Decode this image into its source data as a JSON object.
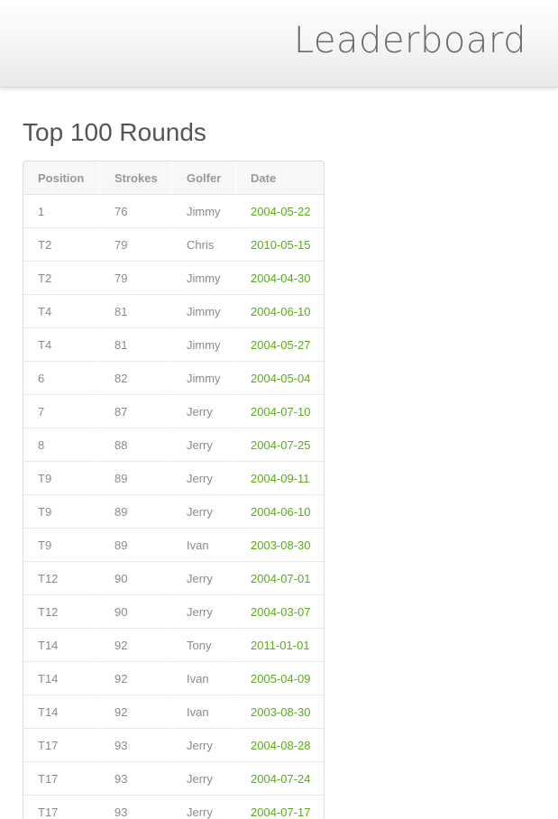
{
  "header": {
    "title": "Leaderboard"
  },
  "page": {
    "heading": "Top 100 Rounds"
  },
  "table": {
    "columns": [
      "Position",
      "Strokes",
      "Golfer",
      "Date"
    ],
    "rows": [
      {
        "position": "1",
        "strokes": "76",
        "golfer": "Jimmy",
        "date": "2004-05-22"
      },
      {
        "position": "T2",
        "strokes": "79",
        "golfer": "Chris",
        "date": "2010-05-15"
      },
      {
        "position": "T2",
        "strokes": "79",
        "golfer": "Jimmy",
        "date": "2004-04-30"
      },
      {
        "position": "T4",
        "strokes": "81",
        "golfer": "Jimmy",
        "date": "2004-06-10"
      },
      {
        "position": "T4",
        "strokes": "81",
        "golfer": "Jimmy",
        "date": "2004-05-27"
      },
      {
        "position": "6",
        "strokes": "82",
        "golfer": "Jimmy",
        "date": "2004-05-04"
      },
      {
        "position": "7",
        "strokes": "87",
        "golfer": "Jerry",
        "date": "2004-07-10"
      },
      {
        "position": "8",
        "strokes": "88",
        "golfer": "Jerry",
        "date": "2004-07-25"
      },
      {
        "position": "T9",
        "strokes": "89",
        "golfer": "Jerry",
        "date": "2004-09-11"
      },
      {
        "position": "T9",
        "strokes": "89",
        "golfer": "Jerry",
        "date": "2004-06-10"
      },
      {
        "position": "T9",
        "strokes": "89",
        "golfer": "Ivan",
        "date": "2003-08-30"
      },
      {
        "position": "T12",
        "strokes": "90",
        "golfer": "Jerry",
        "date": "2004-07-01"
      },
      {
        "position": "T12",
        "strokes": "90",
        "golfer": "Jerry",
        "date": "2004-03-07"
      },
      {
        "position": "T14",
        "strokes": "92",
        "golfer": "Tony",
        "date": "2011-01-01"
      },
      {
        "position": "T14",
        "strokes": "92",
        "golfer": "Ivan",
        "date": "2005-04-09"
      },
      {
        "position": "T14",
        "strokes": "92",
        "golfer": "Ivan",
        "date": "2003-08-30"
      },
      {
        "position": "T17",
        "strokes": "93",
        "golfer": "Jerry",
        "date": "2004-08-28"
      },
      {
        "position": "T17",
        "strokes": "93",
        "golfer": "Jerry",
        "date": "2004-07-24"
      },
      {
        "position": "T17",
        "strokes": "93",
        "golfer": "Jerry",
        "date": "2004-07-17"
      }
    ]
  },
  "colors": {
    "date_link": "#5aac1a",
    "heading": "#555555",
    "cell_text": "#8a8a8a"
  }
}
